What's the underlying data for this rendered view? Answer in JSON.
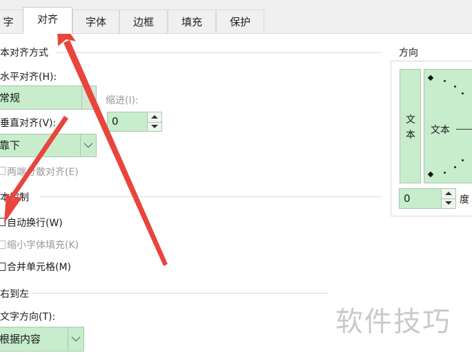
{
  "tabs": [
    {
      "label": "字",
      "active": false
    },
    {
      "label": "对齐",
      "active": true
    },
    {
      "label": "字体",
      "active": false
    },
    {
      "label": "边框",
      "active": false
    },
    {
      "label": "填充",
      "active": false
    },
    {
      "label": "保护",
      "active": false
    }
  ],
  "alignment": {
    "section_title": "本对齐方式",
    "horizontal_label": "水平对齐(H):",
    "horizontal_value": "常规",
    "indent_label": "缩进(I):",
    "indent_value": "0",
    "vertical_label": "垂直对齐(V):",
    "vertical_value": "靠下",
    "justify_distributed_label": "两端分散对齐(E)"
  },
  "text_control": {
    "section_title": "本控制",
    "wrap_label": "自动换行(W)",
    "shrink_label": "缩小字体填充(K)",
    "merge_label": "合并单元格(M)"
  },
  "rtl": {
    "section_title": "右到左",
    "direction_label": "文字方向(T):",
    "direction_value": "根据内容"
  },
  "orientation": {
    "title": "方向",
    "vertical_text": [
      "文",
      "本"
    ],
    "dial_text": "文本",
    "degree_value": "0",
    "degree_label": "度"
  },
  "watermark": "软件技巧",
  "colors": {
    "control_bg": "#c7edcc",
    "arrow": "#e8453c",
    "watermark": "#c9c9c9"
  }
}
